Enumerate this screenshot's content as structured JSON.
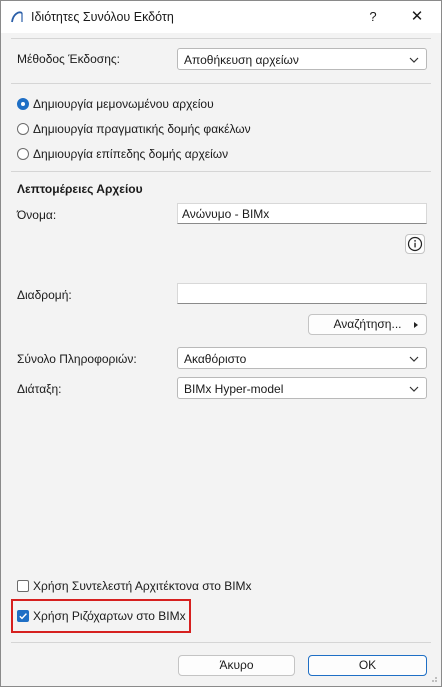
{
  "window": {
    "title": "Ιδιότητες Συνόλου Εκδότη",
    "help_label": "?",
    "close_label": "✕"
  },
  "method": {
    "label": "Μέθοδος Έκδοσης:",
    "value": "Αποθήκευση αρχείων"
  },
  "options": [
    {
      "label": "Δημιουργία μεμονωμένου αρχείου",
      "selected": true
    },
    {
      "label": "Δημιουργία πραγματικής δομής φακέλων",
      "selected": false
    },
    {
      "label": "Δημιουργία επίπεδης δομής αρχείων",
      "selected": false
    }
  ],
  "details": {
    "heading": "Λεπτομέρειες Αρχείου",
    "name_label": "Όνομα:",
    "name_value": "Ανώνυμο - BIMx",
    "path_label": "Διαδρομή:",
    "path_value": "",
    "browse_label": "Αναζήτηση..."
  },
  "info_set": {
    "label": "Σύνολο Πληροφοριών:",
    "value": "Ακαθόριστο"
  },
  "layout": {
    "label": "Διάταξη:",
    "value": "BIMx Hyper-model"
  },
  "checkboxes": [
    {
      "label": "Χρήση Συντελεστή Αρχιτέκτονα στο BIMx",
      "checked": false
    },
    {
      "label": "Χρήση Ριζόχαρτων στο BIMx",
      "checked": true
    }
  ],
  "footer": {
    "cancel_label": "Άκυρο",
    "ok_label": "OK"
  },
  "colors": {
    "accent": "#1f6fc5",
    "highlight": "#d6201f"
  }
}
